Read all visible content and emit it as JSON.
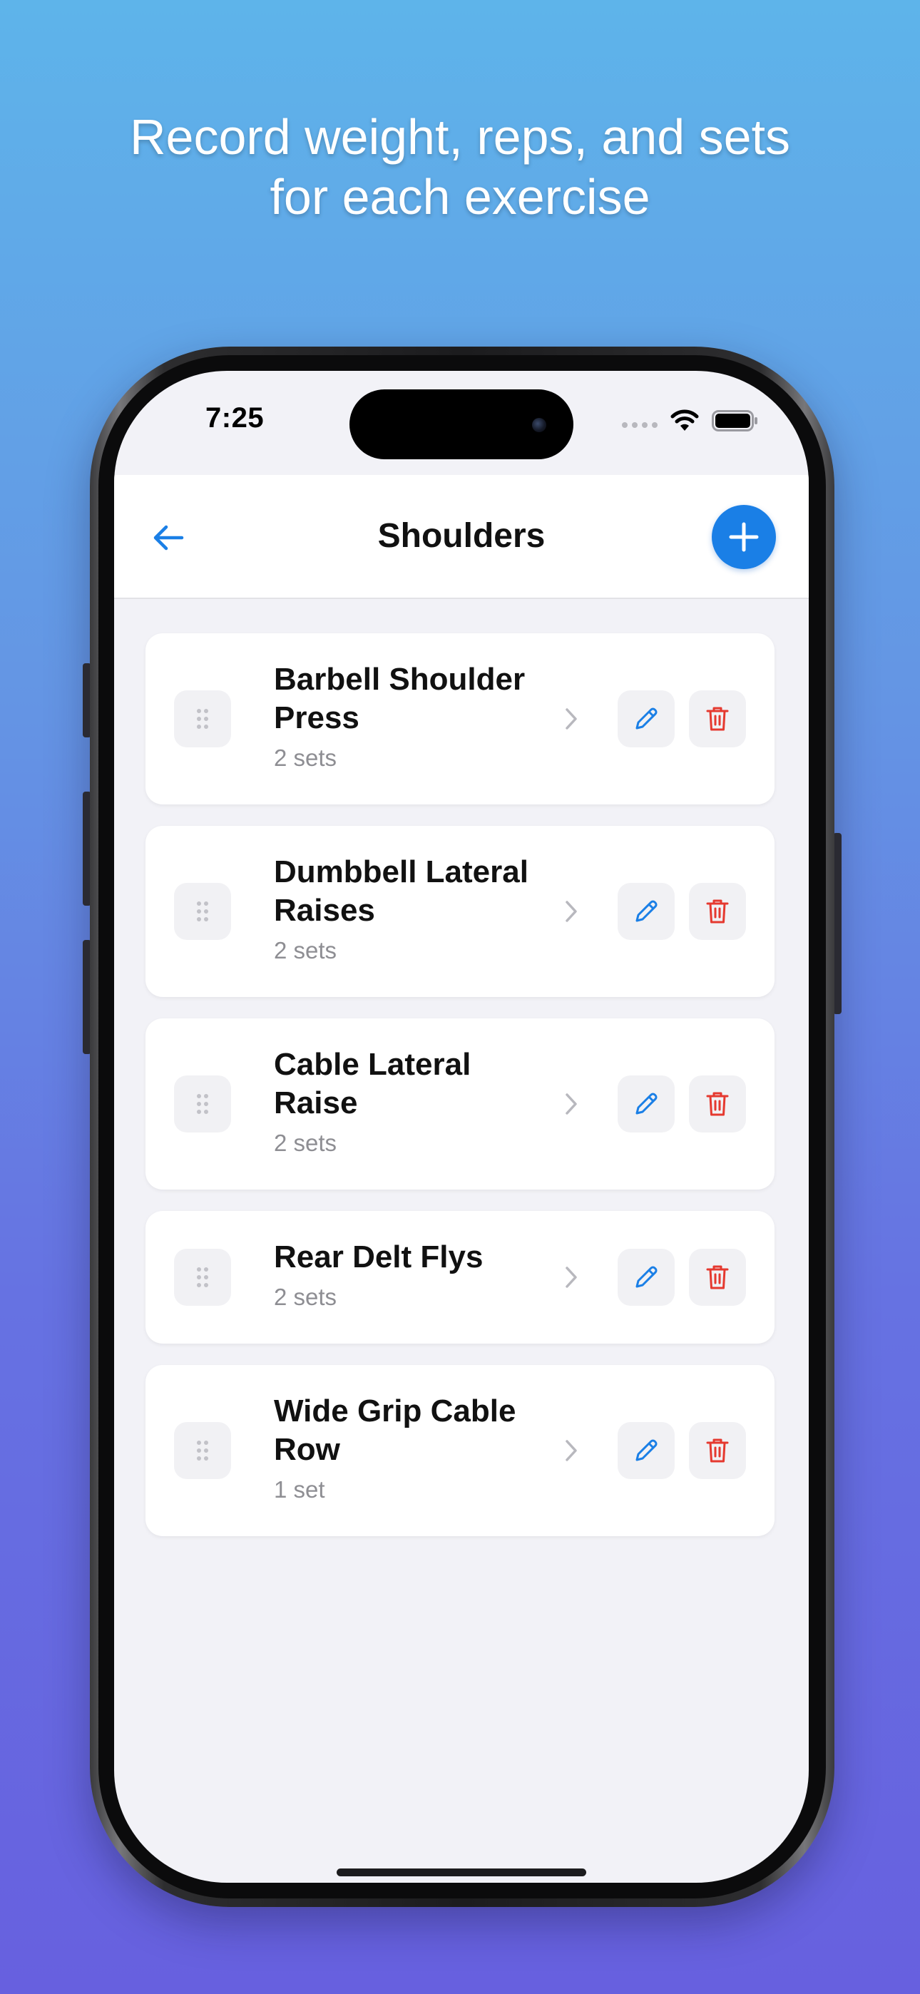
{
  "headline": {
    "line1": "Record weight, reps, and sets",
    "line2": "for each exercise"
  },
  "status_bar": {
    "time": "7:25",
    "icons": [
      "cellular-dots-icon",
      "wifi-icon",
      "battery-icon"
    ]
  },
  "navbar": {
    "title": "Shoulders",
    "back_icon": "arrow-left-icon",
    "add_icon": "plus-icon"
  },
  "colors": {
    "accent": "#1a7fe6",
    "delete": "#e5392f",
    "background": "#f2f2f7"
  },
  "exercises": [
    {
      "name": "Barbell Shoulder Press",
      "sets": "2 sets"
    },
    {
      "name": "Dumbbell Lateral Raises",
      "sets": "2 sets"
    },
    {
      "name": "Cable Lateral Raise",
      "sets": "2 sets"
    },
    {
      "name": "Rear Delt Flys",
      "sets": "2 sets"
    },
    {
      "name": "Wide Grip Cable Row",
      "sets": "1 set"
    }
  ]
}
